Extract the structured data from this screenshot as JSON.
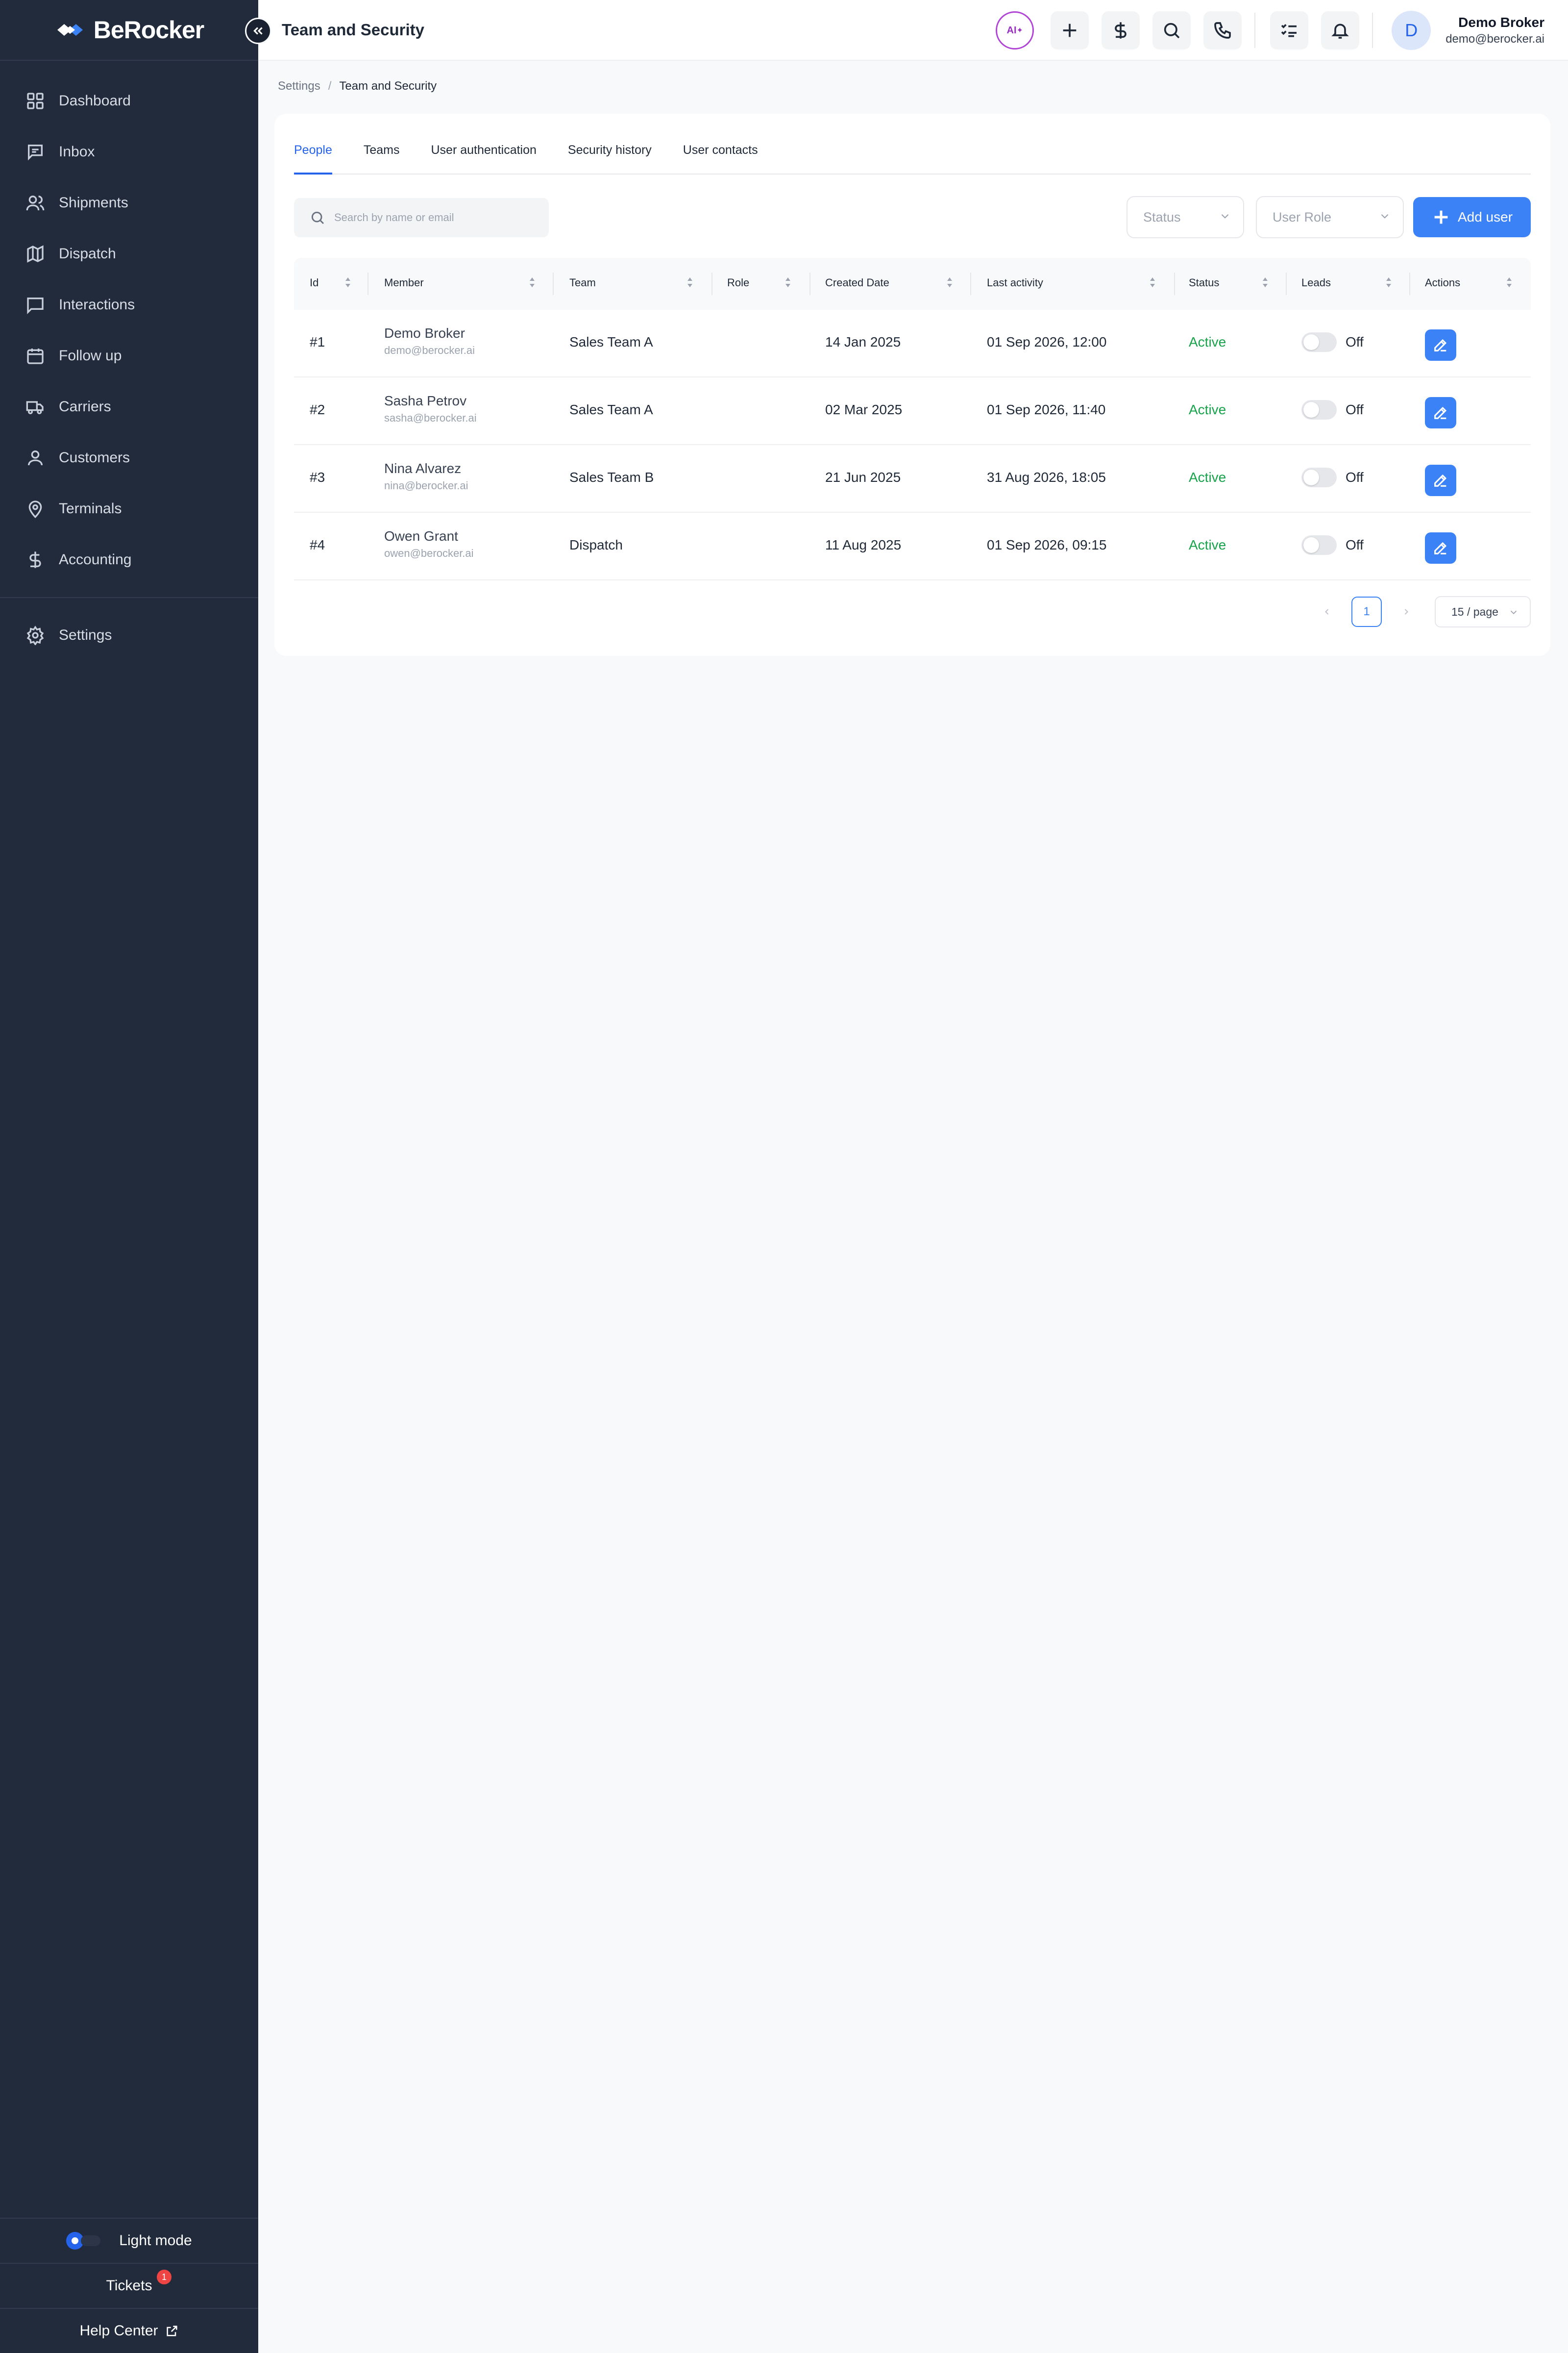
{
  "brand": {
    "name": "BeRocker"
  },
  "sidebar": {
    "items": [
      {
        "label": "Dashboard",
        "icon": "grid-icon"
      },
      {
        "label": "Inbox",
        "icon": "message-square-icon"
      },
      {
        "label": "Shipments",
        "icon": "users-icon"
      },
      {
        "label": "Dispatch",
        "icon": "map-icon"
      },
      {
        "label": "Interactions",
        "icon": "message-icon"
      },
      {
        "label": "Follow up",
        "icon": "calendar-icon"
      },
      {
        "label": "Carriers",
        "icon": "truck-icon"
      },
      {
        "label": "Customers",
        "icon": "user-icon"
      },
      {
        "label": "Terminals",
        "icon": "map-pin-icon"
      },
      {
        "label": "Accounting",
        "icon": "dollar-icon"
      }
    ],
    "settings": {
      "label": "Settings",
      "icon": "gear-icon"
    },
    "bottom": {
      "light_mode": "Light mode",
      "tickets": "Tickets",
      "tickets_badge": "1",
      "help_center": "Help Center"
    }
  },
  "header": {
    "title": "Team and Security",
    "ai_label": "AI",
    "user": {
      "initial": "D",
      "name": "Demo Broker",
      "email": "demo@berocker.ai"
    }
  },
  "breadcrumb": {
    "root": "Settings",
    "separator": "/",
    "current": "Team and Security"
  },
  "tabs": [
    {
      "label": "People",
      "active": true
    },
    {
      "label": "Teams",
      "active": false
    },
    {
      "label": "User authentication",
      "active": false
    },
    {
      "label": "Security history",
      "active": false
    },
    {
      "label": "User contacts",
      "active": false
    }
  ],
  "filters": {
    "search_placeholder": "Search by name or email",
    "status_placeholder": "Status",
    "role_placeholder": "User Role",
    "add_user_label": "Add user"
  },
  "table": {
    "columns": [
      "Id",
      "Member",
      "Team",
      "Role",
      "Created Date",
      "Last activity",
      "Status",
      "Leads",
      "Actions"
    ],
    "rows": [
      {
        "id": "#1",
        "name": "Demo Broker",
        "email": "demo@berocker.ai",
        "team": "Sales Team A",
        "role": "",
        "created": "14 Jan 2025",
        "last_activity": "01 Sep 2026, 12:00",
        "status": "Active",
        "leads": "Off"
      },
      {
        "id": "#2",
        "name": "Sasha Petrov",
        "email": "sasha@berocker.ai",
        "team": "Sales Team A",
        "role": "",
        "created": "02 Mar 2025",
        "last_activity": "01 Sep 2026, 11:40",
        "status": "Active",
        "leads": "Off"
      },
      {
        "id": "#3",
        "name": "Nina Alvarez",
        "email": "nina@berocker.ai",
        "team": "Sales Team B",
        "role": "",
        "created": "21 Jun 2025",
        "last_activity": "31 Aug 2026, 18:05",
        "status": "Active",
        "leads": "Off"
      },
      {
        "id": "#4",
        "name": "Owen Grant",
        "email": "owen@berocker.ai",
        "team": "Dispatch",
        "role": "",
        "created": "11 Aug 2025",
        "last_activity": "01 Sep 2026, 09:15",
        "status": "Active",
        "leads": "Off"
      }
    ]
  },
  "pagination": {
    "current_page": "1",
    "page_size": "15 / page"
  },
  "colors": {
    "accent": "#3b82f6",
    "sidebar_bg": "#222b3c",
    "status_active": "#16a34a",
    "ai_ring": "#b044d6",
    "badge": "#ef4444"
  }
}
